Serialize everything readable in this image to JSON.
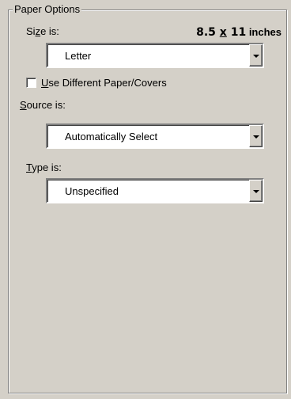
{
  "group": {
    "legend": "Paper Options"
  },
  "size": {
    "label_pre": "Si",
    "label_u": "z",
    "label_post": "e is:",
    "value_w": "8.5",
    "value_x": "x",
    "value_h": "11",
    "value_unit": "inches",
    "selected": "Letter"
  },
  "checkbox": {
    "label_u": "U",
    "label_post": "se Different Paper/Covers",
    "checked": false
  },
  "source": {
    "label_u": "S",
    "label_post": "ource is:",
    "selected": "Automatically Select"
  },
  "type": {
    "label_u": "T",
    "label_post": "ype is:",
    "selected": "Unspecified"
  },
  "icons": {
    "dropdown": "chevron-down-icon"
  }
}
